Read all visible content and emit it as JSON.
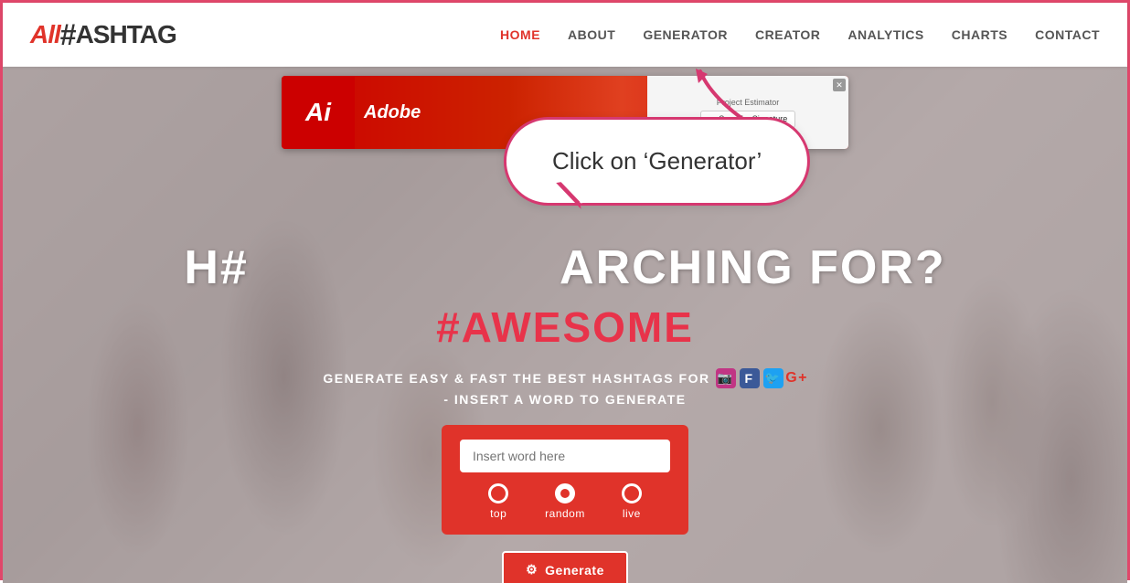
{
  "logo": {
    "all": "All",
    "hash": "#",
    "ashtag": "ASHTAG"
  },
  "nav": {
    "items": [
      {
        "id": "home",
        "label": "HOME",
        "active": true
      },
      {
        "id": "about",
        "label": "ABOUT",
        "active": false
      },
      {
        "id": "generator",
        "label": "GENERATOR",
        "active": false
      },
      {
        "id": "creator",
        "label": "CREATOR",
        "active": false
      },
      {
        "id": "analytics",
        "label": "ANALYTICS",
        "active": false
      },
      {
        "id": "charts",
        "label": "CHARTS",
        "active": false
      },
      {
        "id": "contact",
        "label": "CONTACT",
        "active": false
      }
    ]
  },
  "ad": {
    "logo_text": "Ai",
    "brand": "Adobe",
    "title": "Project Estimator",
    "button_label": "Send for Signature"
  },
  "bubble": {
    "text": "Click on ‘Generator’"
  },
  "hero": {
    "headline": "H#___________ARCHING FOR?",
    "headline_part1": "H#",
    "headline_part2": "ARCHING FOR?",
    "subhead": "#AWESOME",
    "desc1": "GENERATE EASY & FAST THE BEST HASHTAGS FOR",
    "desc2": "- INSERT A WORD TO GENERATE"
  },
  "search": {
    "placeholder": "Insert word here",
    "radio_options": [
      "top",
      "random",
      "live"
    ],
    "selected_radio": "random",
    "generate_button": "Generate"
  },
  "colors": {
    "primary_red": "#e0332a",
    "pink_border": "#d63870",
    "nav_active": "#e0332a"
  }
}
